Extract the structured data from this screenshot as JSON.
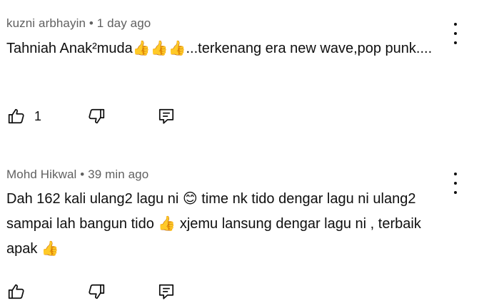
{
  "comments": [
    {
      "author": "kuzni arbhayin",
      "separator": "•",
      "time": "1 day ago",
      "text": "Tahniah Anak²muda👍👍👍...terkenang era new wave,pop punk....",
      "like_count": "1"
    },
    {
      "author": "Mohd Hikwal",
      "separator": "•",
      "time": "39 min ago",
      "text": "Dah 162 kali ulang2 lagu ni 😊 time nk tido dengar lagu ni ulang2 sampai lah bangun tido 👍 xjemu lansung dengar lagu ni , terbaik apak 👍",
      "like_count": ""
    }
  ],
  "icons": {
    "like": "thumbs-up-icon",
    "dislike": "thumbs-down-icon",
    "reply": "reply-comment-icon",
    "more": "vertical-ellipsis-icon"
  }
}
